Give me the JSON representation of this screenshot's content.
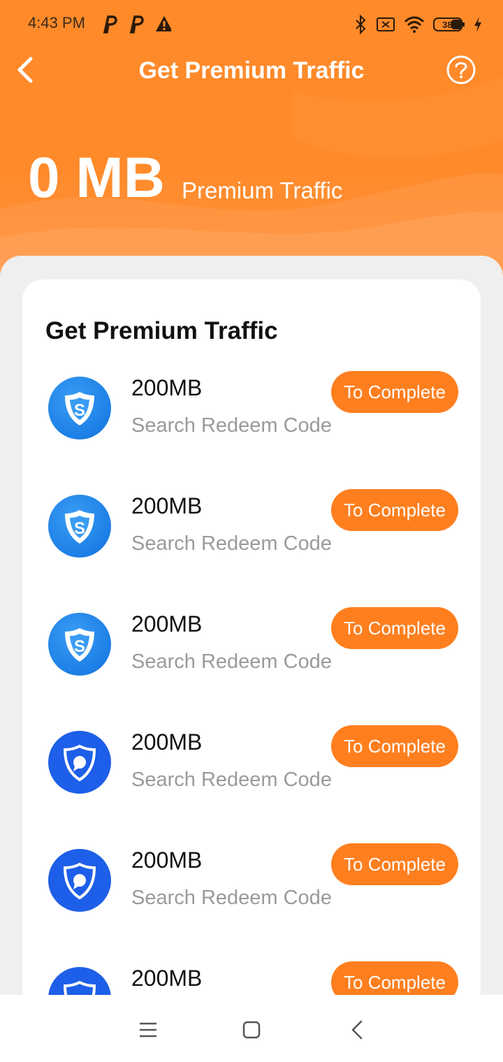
{
  "status_bar": {
    "time": "4:43 PM",
    "left_icons": [
      "p-icon",
      "p-icon",
      "warning-icon"
    ],
    "right_icons": [
      "bluetooth-icon",
      "sim-off-icon",
      "wifi-icon",
      "battery-icon",
      "charging-icon"
    ],
    "battery_level": "38"
  },
  "header": {
    "title": "Get Premium Traffic",
    "back_icon": "chevron-left-icon",
    "help_icon": "help-circle-icon",
    "balance_value": "0 MB",
    "balance_label": "Premium Traffic"
  },
  "card": {
    "title": "Get Premium Traffic",
    "tasks": [
      {
        "icon": "skype-shield-icon",
        "amount": "200MB",
        "description": "Search Redeem Code",
        "button": "To Complete"
      },
      {
        "icon": "skype-shield-icon",
        "amount": "200MB",
        "description": "Search Redeem Code",
        "button": "To Complete"
      },
      {
        "icon": "skype-shield-icon",
        "amount": "200MB",
        "description": "Search Redeem Code",
        "button": "To Complete"
      },
      {
        "icon": "shield-chat-icon",
        "amount": "200MB",
        "description": "Search Redeem Code",
        "button": "To Complete"
      },
      {
        "icon": "shield-chat-icon",
        "amount": "200MB",
        "description": "Search Redeem Code",
        "button": "To Complete"
      },
      {
        "icon": "shield-chat-icon",
        "amount": "200MB",
        "description": "",
        "button": "To Complete"
      }
    ]
  },
  "nav_bar": {
    "icons": [
      "menu-icon",
      "home-icon",
      "back-icon"
    ]
  },
  "colors": {
    "accent": "#ff7f1f",
    "header_bg": "#ff8a2a",
    "skype_blue": "#1c7fe6",
    "shield_blue": "#1d5fe8"
  }
}
